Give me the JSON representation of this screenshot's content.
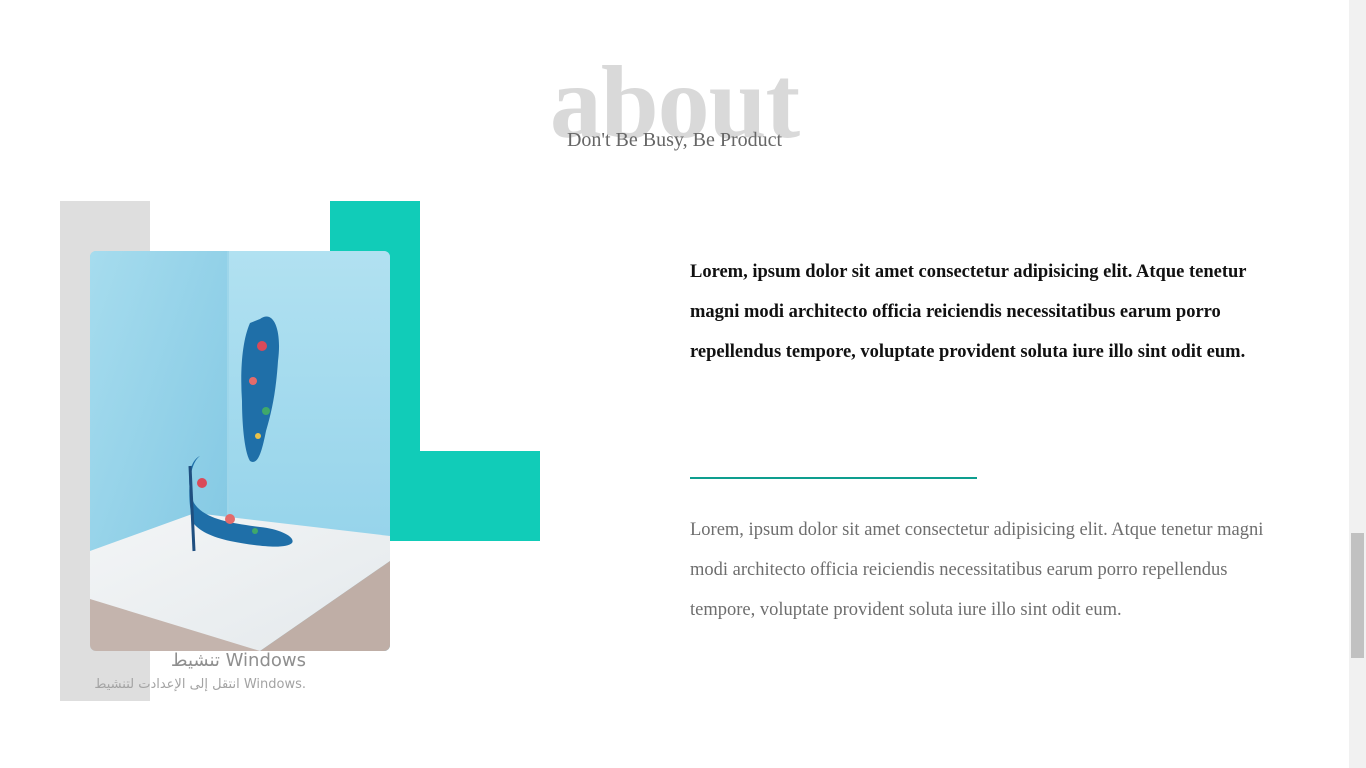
{
  "about": {
    "title": "about",
    "subtitle": "Don't Be Busy, Be Product",
    "lead": "Lorem, ipsum dolor sit amet consectetur adipisicing elit. Atque tenetur magni modi architecto officia reiciendis necessitatibus earum porro repellendus tempore, voluptate provident soluta iure illo sint odit eum.",
    "body": "Lorem, ipsum dolor sit amet consectetur adipisicing elit. Atque tenetur magni modi architecto officia reiciendis necessitatibus earum porro repellendus tempore, voluptate provident soluta iure illo sint odit eum.",
    "image_alt": "blue floral high heel shoes"
  },
  "watermark": {
    "title": "تنشيط Windows",
    "subtitle": "انتقل إلى الإعدادت لتنشيط Windows."
  },
  "colors": {
    "accent": "#11ccb8",
    "divider": "#0e9e8f",
    "gray_block": "#dedede"
  }
}
